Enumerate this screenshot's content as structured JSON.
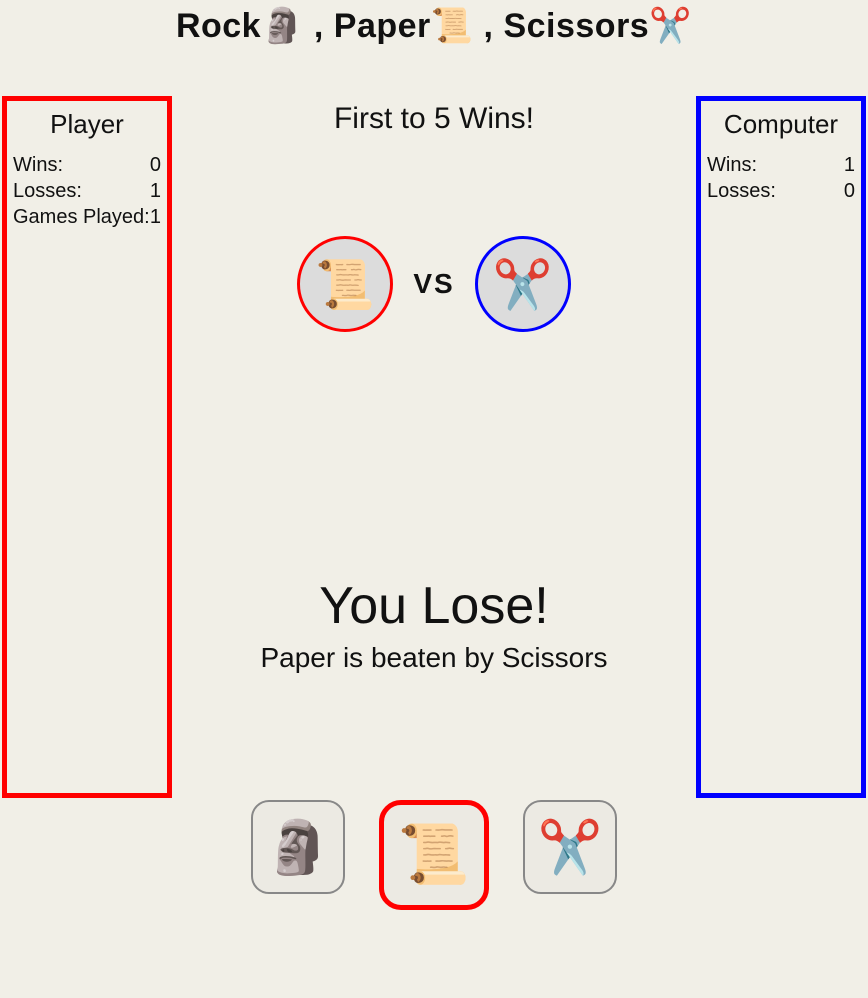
{
  "title": {
    "word1": "Rock",
    "word2": "Paper",
    "word3": "Scissors",
    "icon1": "🗿",
    "icon2": "📜",
    "icon3": "✂️",
    "sep": " , "
  },
  "subtitle": "First to 5 Wins!",
  "player_panel": {
    "title": "Player",
    "wins_label": "Wins:",
    "wins": "0",
    "losses_label": "Losses:",
    "losses": "1",
    "games_label": "Games Played:",
    "games": "1"
  },
  "computer_panel": {
    "title": "Computer",
    "wins_label": "Wins:",
    "wins": "1",
    "losses_label": "Losses:",
    "losses": "0"
  },
  "round": {
    "player_choice_icon": "📜",
    "computer_choice_icon": "✂️",
    "vs_label": "VS"
  },
  "result": {
    "headline": "You Lose!",
    "explanation": "Paper is beaten by Scissors"
  },
  "choices": {
    "rock_icon": "🗿",
    "paper_icon": "📜",
    "scissors_icon": "✂️"
  }
}
